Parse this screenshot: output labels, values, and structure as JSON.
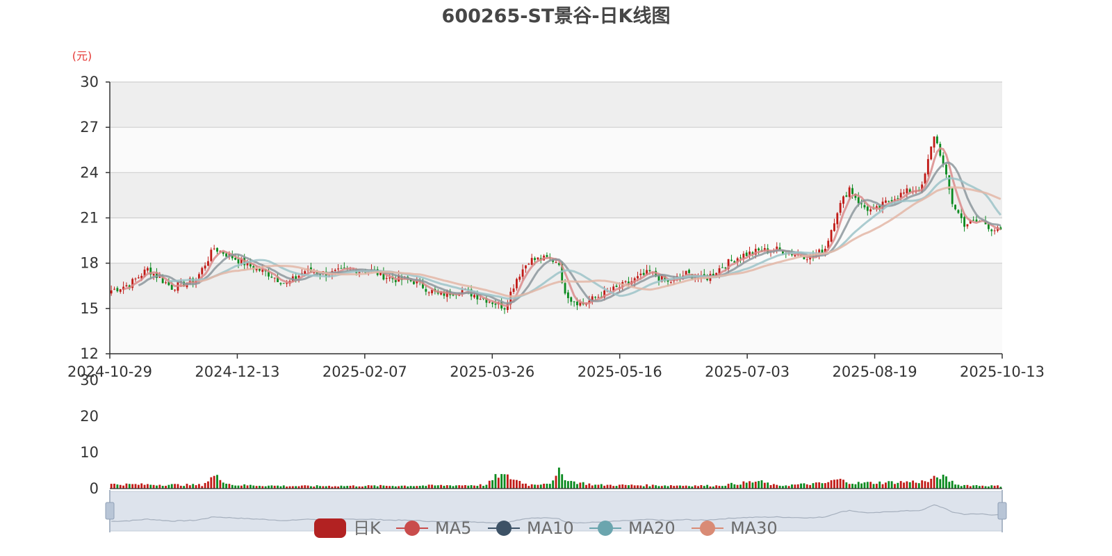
{
  "chart_data": {
    "type": "candlestick",
    "title": "600265-ST景谷-日K线图",
    "unit": "(元)",
    "ylim": [
      12,
      30
    ],
    "y_ticks": [
      "30",
      "27",
      "24",
      "21",
      "18",
      "15",
      "12"
    ],
    "x_ticks": [
      "2024-10-29",
      "2024-12-13",
      "2025-02-07",
      "2025-03-26",
      "2025-05-16",
      "2025-07-03",
      "2025-08-19",
      "2025-10-13"
    ],
    "volume_ylim": [
      0,
      30
    ],
    "volume_ticks": [
      "30",
      "20",
      "10",
      "0"
    ],
    "legend": [
      "日K",
      "MA5",
      "MA10",
      "MA20",
      "MA30"
    ],
    "colors": {
      "up": "#c11b17",
      "down": "#0a8a1f",
      "MA5": "#d98a8a",
      "MA10": "#8c969c",
      "MA20": "#9cc3c8",
      "MA30": "#e3b6a6",
      "legend_kline": "#b22222",
      "legend_ma5": "#c94c4c",
      "legend_ma10": "#3d5266",
      "legend_ma20": "#6ba5ae",
      "legend_ma30": "#d98b75"
    },
    "close_anchors": [
      [
        0,
        16.2
      ],
      [
        6,
        16.6
      ],
      [
        12,
        17.6
      ],
      [
        20,
        16.4
      ],
      [
        28,
        16.9
      ],
      [
        34,
        19.0
      ],
      [
        40,
        18.4
      ],
      [
        46,
        17.8
      ],
      [
        52,
        17.3
      ],
      [
        58,
        16.6
      ],
      [
        64,
        17.5
      ],
      [
        72,
        17.3
      ],
      [
        80,
        17.6
      ],
      [
        86,
        17.5
      ],
      [
        92,
        17.0
      ],
      [
        100,
        16.8
      ],
      [
        108,
        15.9
      ],
      [
        116,
        16.2
      ],
      [
        124,
        15.6
      ],
      [
        130,
        15.1
      ],
      [
        134,
        17.0
      ],
      [
        138,
        18.2
      ],
      [
        144,
        18.3
      ],
      [
        148,
        18.1
      ],
      [
        149,
        16.5
      ],
      [
        152,
        15.6
      ],
      [
        156,
        15.3
      ],
      [
        162,
        15.9
      ],
      [
        170,
        16.6
      ],
      [
        178,
        17.4
      ],
      [
        184,
        16.7
      ],
      [
        190,
        17.3
      ],
      [
        196,
        16.9
      ],
      [
        202,
        17.8
      ],
      [
        208,
        18.5
      ],
      [
        214,
        18.8
      ],
      [
        220,
        18.9
      ],
      [
        226,
        18.6
      ],
      [
        232,
        18.4
      ],
      [
        236,
        19.0
      ],
      [
        240,
        21.5
      ],
      [
        244,
        23.0
      ],
      [
        248,
        21.8
      ],
      [
        252,
        21.4
      ],
      [
        258,
        22.3
      ],
      [
        264,
        22.8
      ],
      [
        268,
        23.0
      ],
      [
        272,
        26.5
      ],
      [
        274,
        25.3
      ],
      [
        278,
        22.0
      ],
      [
        282,
        20.6
      ],
      [
        288,
        20.8
      ],
      [
        291,
        20.3
      ],
      [
        294,
        20.1
      ]
    ],
    "volume_anchors": [
      [
        0,
        1.2
      ],
      [
        30,
        1.0
      ],
      [
        34,
        3.5
      ],
      [
        40,
        1.0
      ],
      [
        60,
        0.7
      ],
      [
        100,
        0.8
      ],
      [
        124,
        1.0
      ],
      [
        128,
        3.8
      ],
      [
        132,
        3.0
      ],
      [
        138,
        1.0
      ],
      [
        146,
        1.8
      ],
      [
        148,
        4.5
      ],
      [
        152,
        2.0
      ],
      [
        160,
        1.0
      ],
      [
        200,
        0.8
      ],
      [
        214,
        2.0
      ],
      [
        220,
        0.8
      ],
      [
        236,
        1.5
      ],
      [
        240,
        2.5
      ],
      [
        246,
        1.5
      ],
      [
        270,
        2.0
      ],
      [
        274,
        3.5
      ],
      [
        280,
        1.0
      ],
      [
        294,
        0.7
      ]
    ]
  }
}
